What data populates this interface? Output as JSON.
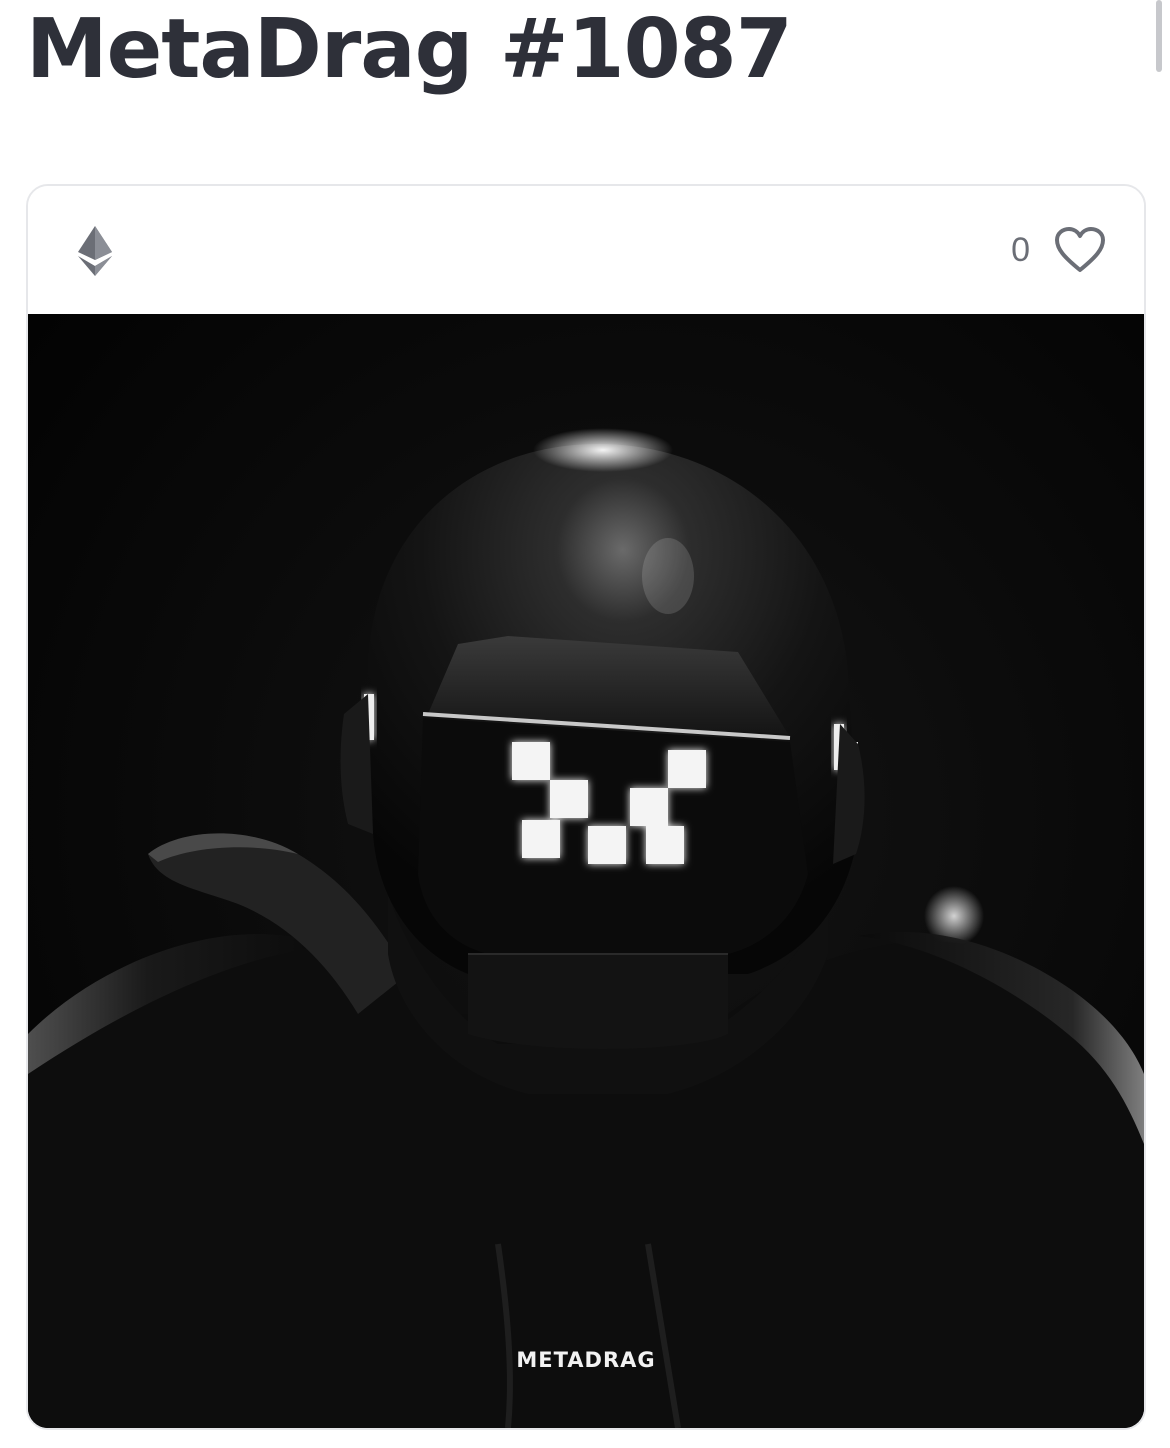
{
  "page": {
    "title": "MetaDrag #1087"
  },
  "card": {
    "chain_icon": "ethereum-icon",
    "like_count": "0",
    "like_icon": "heart-outline-icon",
    "artwork": {
      "subject": "metadrag-character-image",
      "wordmark": "METADRAG"
    }
  },
  "colors": {
    "title": "#2e3039",
    "card_border": "#e6e7ea",
    "icon_gray": "#6b6e76",
    "image_background": "#050505",
    "led_glow": "#f4f4f4"
  }
}
